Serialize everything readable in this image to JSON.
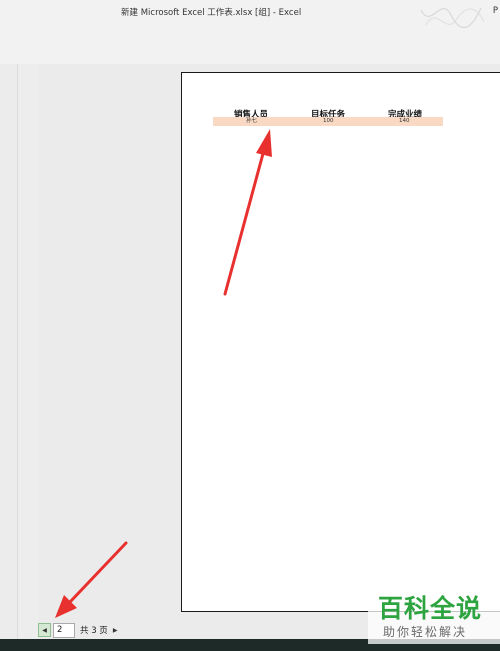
{
  "window": {
    "title": "新建 Microsoft Excel 工作表.xlsx  [组]  -  Excel",
    "corner_text": "P"
  },
  "sheet": {
    "headers": [
      "销售人员",
      "目标任务",
      "完成业绩"
    ],
    "row": [
      "孙七",
      "100",
      "140"
    ],
    "row_fill_color": "#f9d9c4"
  },
  "pager": {
    "prev_icon": "triangle-left-icon",
    "current_page": "2",
    "total_label": "共 3 页",
    "next_icon": "triangle-right-icon"
  },
  "annotations": {
    "arrow_color": "#e8312f"
  },
  "watermark": {
    "title": "百科全说",
    "subtitle": "助你轻松解决"
  }
}
